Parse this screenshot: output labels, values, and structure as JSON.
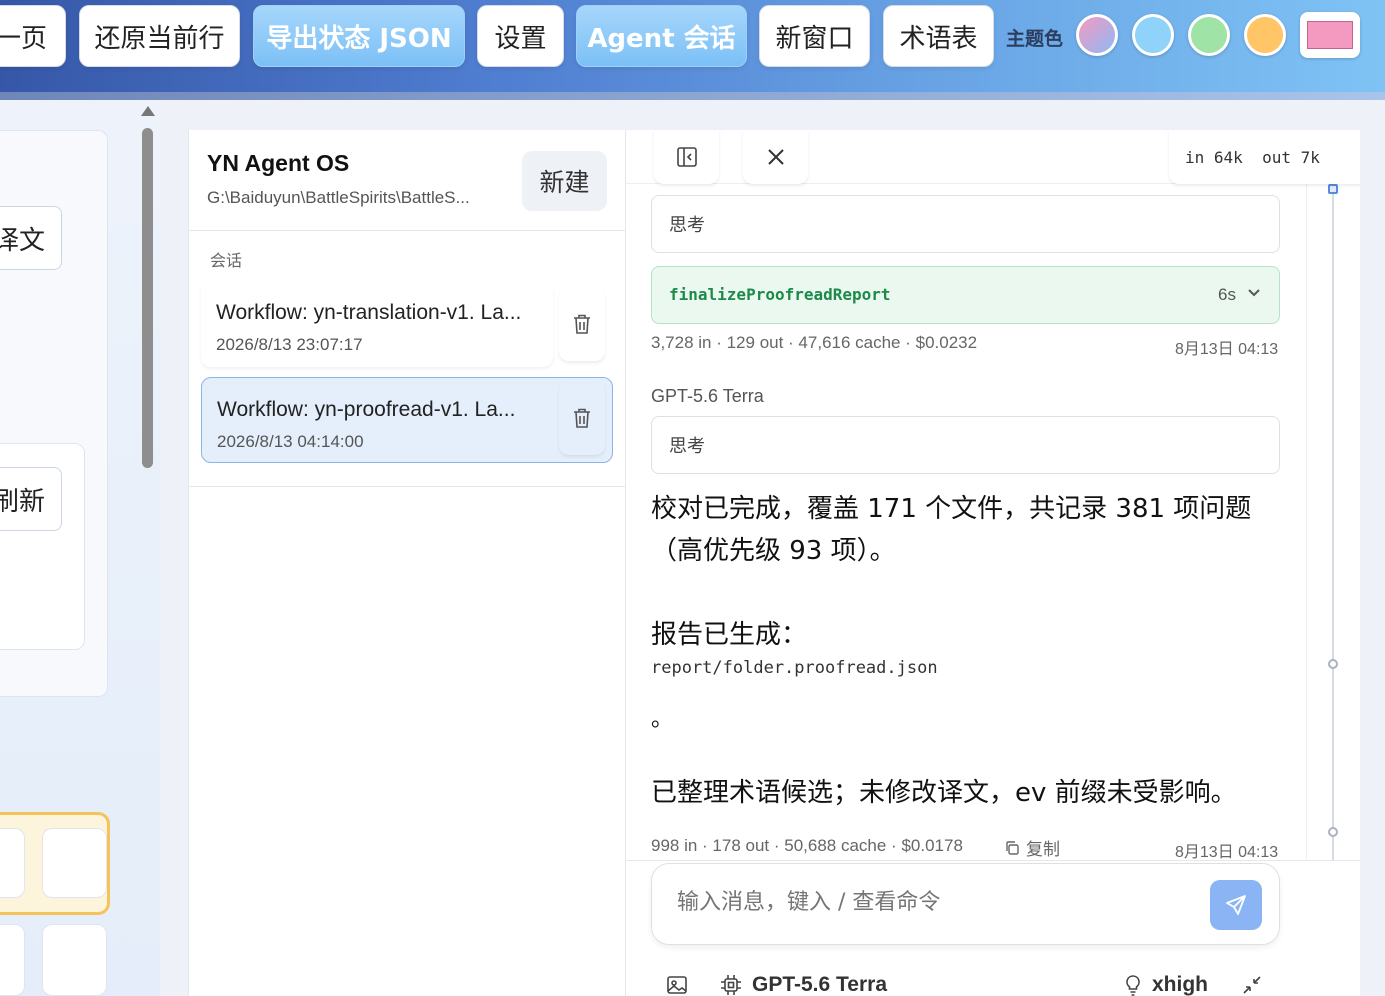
{
  "toolbar": {
    "buttons": [
      {
        "label": "一页"
      },
      {
        "label": "还原当前行"
      },
      {
        "label": "导出状态 JSON"
      },
      {
        "label": "设置"
      },
      {
        "label": "Agent 会话"
      },
      {
        "label": "新窗口"
      },
      {
        "label": "术语表"
      }
    ],
    "theme_label": "主题色",
    "theme_colors": [
      "#c9a3e8",
      "#8fd3fb",
      "#9fe3a6",
      "#ffc567",
      "#f49ac0"
    ]
  },
  "left_panel": {
    "button1": "译文",
    "button2": "刷新"
  },
  "sessions": {
    "workspace_title": "YN Agent OS",
    "workspace_path": "G:\\Baiduyun\\BattleSpirits\\BattleS...",
    "new_label": "新建",
    "section_label": "会话",
    "items": [
      {
        "title": "Workflow: yn-translation-v1. La...",
        "date": "2026/8/13 23:07:17",
        "active": false
      },
      {
        "title": "Workflow: yn-proofread-v1. La...",
        "date": "2026/8/13 04:14:00",
        "active": true
      }
    ]
  },
  "chat": {
    "tokens": "in 64k  out 7k",
    "think_label_1": "思考",
    "tool_name": "finalizeProofreadReport",
    "tool_time": "6s",
    "meta_1": "3,728 in · 129 out · 47,616 cache · $0.0232",
    "time_1": "8月13日 04:13",
    "model_name": "GPT-5.6 Terra",
    "think_label_2": "思考",
    "msg_1": "校对已完成，覆盖 171 个文件，共记录 381 项问题（高优先级 93 项）。",
    "msg_2": "报告已生成：",
    "code": "report/folder.proofread.json",
    "dot": "。",
    "msg_3": "已整理术语候选；未修改译文，ev 前缀未受影响。",
    "meta_2": "998 in · 178 out · 50,688 cache · $0.0178",
    "copy_label": "复制",
    "time_2": "8月13日 04:13",
    "input_placeholder": "输入消息，键入 / 查看命令",
    "footer_model": "GPT-5.6 Terra",
    "reasoning": "xhigh"
  }
}
